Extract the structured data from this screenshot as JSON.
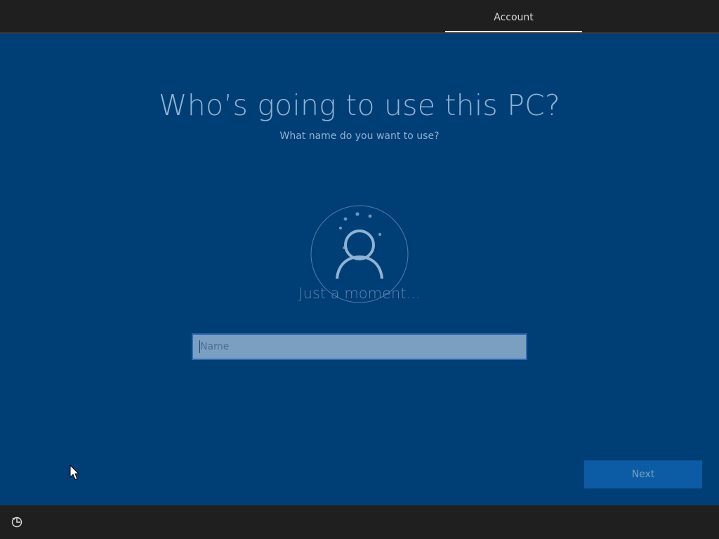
{
  "header": {
    "tab_label": "Account"
  },
  "main": {
    "title": "Who’s going to use this PC?",
    "subtitle": "What name do you want to use?",
    "loading_text": "Just a moment...",
    "name_input": {
      "placeholder": "Name",
      "value": ""
    },
    "next_label": "Next"
  },
  "icons": {
    "avatar": "user-avatar-icon",
    "spinner": "loading-spinner-icon",
    "accessibility": "ease-of-access-icon",
    "cursor": "mouse-pointer-icon"
  },
  "colors": {
    "background": "#003e76",
    "bar": "#1f1f1f",
    "text_primary": "#8fb3d3",
    "input_bg": "#7b9fc0",
    "button_bg": "#0b5ca4"
  }
}
